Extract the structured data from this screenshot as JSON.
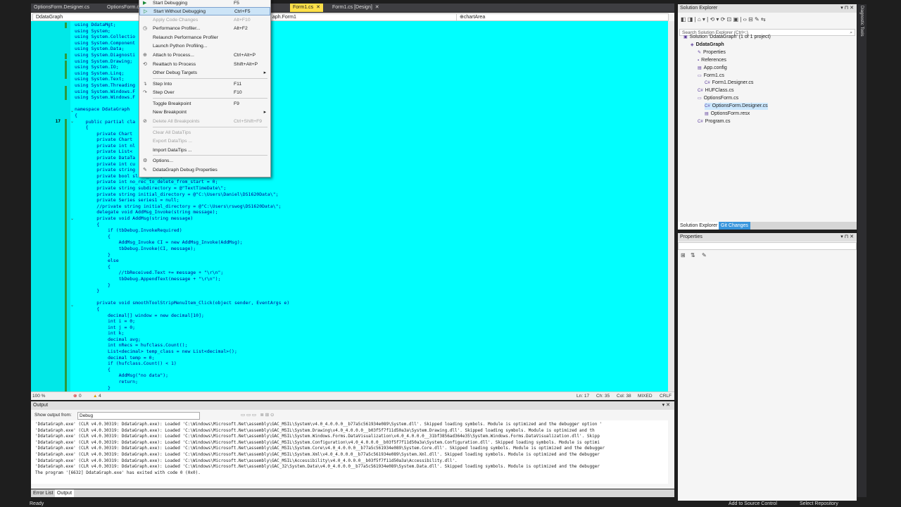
{
  "tabs": [
    {
      "label": "OptionsForm.Designer.cs",
      "active": false
    },
    {
      "label": "OptionsForm.c",
      "active": false
    },
    {
      "label": "Form1.cs",
      "active": true
    },
    {
      "label": "Form1.cs [Design]",
      "active": false
    }
  ],
  "navbar": {
    "project": "DdataGraph",
    "class": "aph.Form1",
    "member": "chartArea"
  },
  "menu": {
    "items": [
      {
        "label": "Start Debugging",
        "shortcut": "F5",
        "icon": "play-icon",
        "disabled": false
      },
      {
        "label": "Start Without Debugging",
        "shortcut": "Ctrl+F5",
        "icon": "play-outline-icon",
        "disabled": false,
        "highlighted": true
      },
      {
        "label": "Apply Code Changes",
        "shortcut": "Alt+F10",
        "icon": "",
        "disabled": true
      },
      {
        "label": "Performance Profiler...",
        "shortcut": "Alt+F2",
        "icon": "profiler-icon",
        "disabled": false
      },
      {
        "label": "Relaunch Performance Profiler",
        "shortcut": "",
        "icon": "",
        "disabled": false
      },
      {
        "label": "Launch Python Profiling...",
        "shortcut": "",
        "icon": "",
        "disabled": false
      },
      {
        "label": "Attach to Process...",
        "shortcut": "Ctrl+Alt+P",
        "icon": "attach-icon",
        "disabled": false
      },
      {
        "label": "Reattach to Process",
        "shortcut": "Shift+Alt+P",
        "icon": "reattach-icon",
        "disabled": false
      },
      {
        "label": "Other Debug Targets",
        "shortcut": "",
        "icon": "",
        "disabled": false,
        "submenu": true
      },
      {
        "label": "Step Into",
        "shortcut": "F11",
        "icon": "step-into-icon",
        "disabled": false
      },
      {
        "label": "Step Over",
        "shortcut": "F10",
        "icon": "step-over-icon",
        "disabled": false
      },
      {
        "label": "Toggle Breakpoint",
        "shortcut": "F9",
        "icon": "",
        "disabled": false
      },
      {
        "label": "New Breakpoint",
        "shortcut": "",
        "icon": "",
        "disabled": false,
        "submenu": true
      },
      {
        "label": "Delete All Breakpoints",
        "shortcut": "Ctrl+Shift+F9",
        "icon": "delete-breakpoints-icon",
        "disabled": true
      },
      {
        "label": "Clear All DataTips",
        "shortcut": "",
        "icon": "",
        "disabled": true
      },
      {
        "label": "Export DataTips ...",
        "shortcut": "",
        "icon": "",
        "disabled": true
      },
      {
        "label": "Import DataTips ...",
        "shortcut": "",
        "icon": "",
        "disabled": false
      },
      {
        "label": "Options...",
        "shortcut": "",
        "icon": "gear-icon",
        "disabled": false
      },
      {
        "label": "DdataGraph Debug Properties",
        "shortcut": "",
        "icon": "wrench-icon",
        "disabled": false
      }
    ]
  },
  "code": {
    "line_number": "17",
    "lines": [
      "using DdataMgt;",
      "using System;",
      "using System.Collectio",
      "using System.Component",
      "using System.Data;",
      "using System.Diagnosti",
      "using System.Drawing;",
      "using System.IO;",
      "using System.Linq;",
      "using System.Text;",
      "using System.Threading",
      "using System.Windows.F",
      "using System.Windows.F",
      "",
      "namespace DdataGraph",
      "{",
      "    public partial cla",
      "    {",
      "        private Chart",
      "        private Chart",
      "        private int nl",
      "        private List<",
      "        private DataTa",
      "        private int cu",
      "        private string",
      "        private bool slide_data;",
      "        private int no_rec_to_delete_from_start = 0;",
      "        private string subdirectory = @\"TextTimeDate\\\";",
      "        private string initial_directory = @\"C:\\Users\\Daniel\\DS1620Data\\\";",
      "        private Series series1 = null;",
      "        //private string initial_directory = @\"C:\\Users\\rswog\\DS1620Data\\\";",
      "        delegate void AddMsg_Invoke(string message);",
      "        private void AddMsg(string message)",
      "        {",
      "            if (tbDebug.InvokeRequired)",
      "            {",
      "                AddMsg_Invoke CI = new AddMsg_Invoke(AddMsg);",
      "                tbDebug.Invoke(CI, message);",
      "            }",
      "            else",
      "            {",
      "                //tbReceived.Text += message + \"\\r\\n\";",
      "                tbDebug.AppendText(message + \"\\r\\n\");",
      "            }",
      "        }",
      "",
      "        private void smoothToolStripMenuItem_Click(object sender, EventArgs e)",
      "        {",
      "            decimal[] window = new decimal[10];",
      "            int i = 0;",
      "            int j = 0;",
      "            int k;",
      "            decimal avg;",
      "            int nRecs = hufclass.Count();",
      "            List<decimal> temp_class = new List<decimal>();",
      "            decimal temp = 0;",
      "            if (hufclass.Count() < 1)",
      "            {",
      "                AddMsg(\"no data\");",
      "                return;",
      "            }"
    ]
  },
  "editor_status": {
    "zoom": "100 %",
    "errors": "0",
    "warnings": "4",
    "line": "Ln: 17",
    "char": "Ch: 35",
    "col": "Col: 38",
    "mixed": "MIXED",
    "eol": "CRLF"
  },
  "output": {
    "title": "Output",
    "show_from_label": "Show output from:",
    "show_from_value": "Debug",
    "lines": [
      "'DdataGraph.exe' (CLR v4.0.30319: DdataGraph.exe): Loaded 'C:\\Windows\\Microsoft.Net\\assembly\\GAC_MSIL\\System\\v4.0_4.0.0.0__b77a5c561934e089\\System.dll'. Skipped loading symbols. Module is optimized and the debugger option '",
      "'DdataGraph.exe' (CLR v4.0.30319: DdataGraph.exe): Loaded 'C:\\Windows\\Microsoft.Net\\assembly\\GAC_MSIL\\System.Drawing\\v4.0_4.0.0.0__b03f5f7f11d50a3a\\System.Drawing.dll'. Skipped loading symbols. Module is optimized and th",
      "'DdataGraph.exe' (CLR v4.0.30319: DdataGraph.exe): Loaded 'C:\\Windows\\Microsoft.Net\\assembly\\GAC_MSIL\\System.Windows.Forms.DataVisualization\\v4.0_4.0.0.0__31bf3856ad364e35\\System.Windows.Forms.DataVisualization.dll'. Skipp",
      "'DdataGraph.exe' (CLR v4.0.30319: DdataGraph.exe): Loaded 'C:\\Windows\\Microsoft.Net\\assembly\\GAC_MSIL\\System.Configuration\\v4.0_4.0.0.0__b03f5f7f11d50a3a\\System.Configuration.dll'. Skipped loading symbols. Module is optimi",
      "'DdataGraph.exe' (CLR v4.0.30319: DdataGraph.exe): Loaded 'C:\\Windows\\Microsoft.Net\\assembly\\GAC_MSIL\\System.Core\\v4.0_4.0.0.0__b77a5c561934e089\\System.Core.dll'. Skipped loading symbols. Module is optimized and the debugger",
      "'DdataGraph.exe' (CLR v4.0.30319: DdataGraph.exe): Loaded 'C:\\Windows\\Microsoft.Net\\assembly\\GAC_MSIL\\System.Xml\\v4.0_4.0.0.0__b77a5c561934e089\\System.Xml.dll'. Skipped loading symbols. Module is optimized and the debugger",
      "'DdataGraph.exe' (CLR v4.0.30319: DdataGraph.exe): Loaded 'C:\\Windows\\Microsoft.Net\\assembly\\GAC_MSIL\\Accessibility\\v4.0_4.0.0.0__b03f5f7f11d50a3a\\Accessibility.dll'.",
      "'DdataGraph.exe' (CLR v4.0.30319: DdataGraph.exe): Loaded 'C:\\Windows\\Microsoft.Net\\assembly\\GAC_32\\System.Data\\v4.0_4.0.0.0__b77a5c561934e089\\System.Data.dll'. Skipped loading symbols. Module is optimized and the debugger",
      "The program '[6632] DdataGraph.exe' has exited with code 0 (0x0)."
    ],
    "tabs": [
      "Error List",
      "Output"
    ]
  },
  "solution_explorer": {
    "title": "Solution Explorer",
    "search_placeholder": "Search Solution Explorer (Ctrl+;)",
    "tree": [
      {
        "label": "Solution 'DdataGraph' (1 of 1 project)",
        "indent": 0,
        "icon": "solution-icon"
      },
      {
        "label": "DdataGraph",
        "indent": 1,
        "icon": "csharp-project-icon",
        "bold": true
      },
      {
        "label": "Properties",
        "indent": 2,
        "icon": "wrench-icon"
      },
      {
        "label": "References",
        "indent": 2,
        "icon": "references-icon"
      },
      {
        "label": "App.config",
        "indent": 2,
        "icon": "config-icon"
      },
      {
        "label": "Form1.cs",
        "indent": 2,
        "icon": "form-icon"
      },
      {
        "label": "Form1.Designer.cs",
        "indent": 3,
        "icon": "cs-file-icon"
      },
      {
        "label": "HUFClass.cs",
        "indent": 2,
        "icon": "cs-file-icon"
      },
      {
        "label": "OptionsForm.cs",
        "indent": 2,
        "icon": "form-icon"
      },
      {
        "label": "OptionsForm.Designer.cs",
        "indent": 3,
        "icon": "cs-file-icon",
        "selected": true
      },
      {
        "label": "OptionsForm.resx",
        "indent": 3,
        "icon": "resx-icon"
      },
      {
        "label": "Program.cs",
        "indent": 2,
        "icon": "cs-file-icon"
      }
    ],
    "tabs": [
      "Solution Explorer",
      "Git Changes"
    ]
  },
  "properties": {
    "title": "Properties"
  },
  "side_label": "Diagnostic Tools",
  "statusbar": {
    "left": "Ready",
    "add_source": "Add to Source Control",
    "select_repo": "Select Repository"
  }
}
